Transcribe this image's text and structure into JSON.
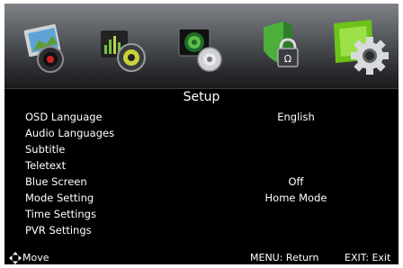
{
  "menu": {
    "tabs": [
      {
        "icon": "picture-icon",
        "selected": false
      },
      {
        "icon": "music-icon",
        "selected": false
      },
      {
        "icon": "movie-icon",
        "selected": false
      },
      {
        "icon": "lock-icon",
        "selected": false
      },
      {
        "icon": "gear-icon",
        "selected": true
      }
    ]
  },
  "page": {
    "title": "Setup"
  },
  "settings": {
    "items": [
      {
        "label": "OSD Language",
        "value": "English"
      },
      {
        "label": "Audio Languages",
        "value": ""
      },
      {
        "label": "Subtitle",
        "value": ""
      },
      {
        "label": "Teletext",
        "value": ""
      },
      {
        "label": "Blue Screen",
        "value": "Off"
      },
      {
        "label": "Mode Setting",
        "value": "Home Mode"
      },
      {
        "label": "Time Settings",
        "value": ""
      },
      {
        "label": "PVR Settings",
        "value": ""
      }
    ]
  },
  "footer": {
    "move": "Move",
    "menu_return": "MENU: Return",
    "exit": "EXIT: Exit"
  },
  "colors": {
    "background": "#000000",
    "selected_tab": "#6cc31a",
    "text": "#ffffff"
  }
}
